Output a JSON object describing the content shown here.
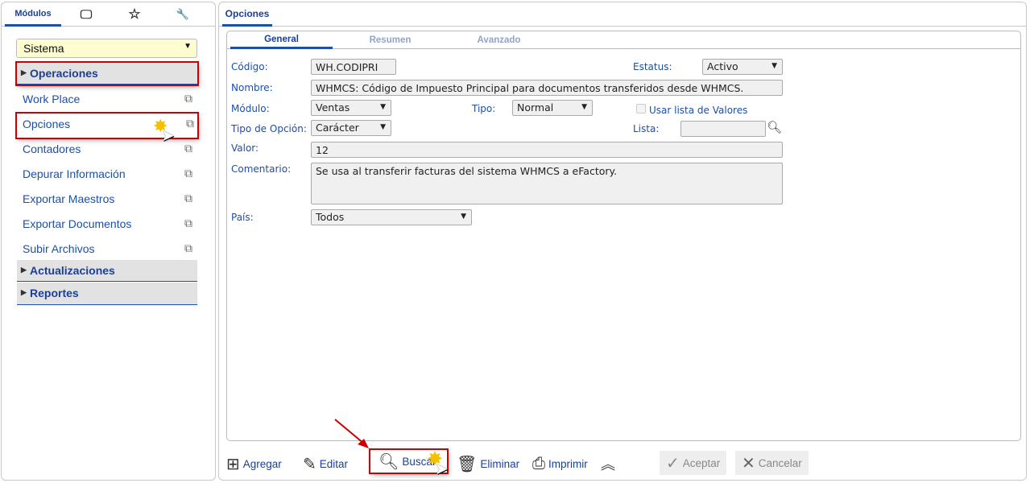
{
  "sidebar": {
    "tabs": [
      {
        "label": "Módulos"
      },
      {
        "icon": "monitor-icon"
      },
      {
        "icon": "star-icon"
      },
      {
        "icon": "tool-icon"
      }
    ],
    "module_select": "Sistema",
    "sections": [
      {
        "label": "Operaciones"
      },
      {
        "label": "Actualizaciones"
      },
      {
        "label": "Reportes"
      }
    ],
    "items": [
      {
        "label": "Work Place"
      },
      {
        "label": "Opciones"
      },
      {
        "label": "Contadores"
      },
      {
        "label": "Depurar Información"
      },
      {
        "label": "Exportar Maestros"
      },
      {
        "label": "Exportar Documentos"
      },
      {
        "label": "Subir Archivos"
      }
    ]
  },
  "main": {
    "tab": "Opciones",
    "subtabs": [
      "General",
      "Resumen",
      "Avanzado"
    ],
    "form": {
      "codigo_label": "Código:",
      "codigo": "WH.CODIPRI",
      "estatus_label": "Estatus:",
      "estatus": "Activo",
      "nombre_label": "Nombre:",
      "nombre": "WHMCS: Código de Impuesto Principal para documentos transferidos desde WHMCS.",
      "modulo_label": "Módulo:",
      "modulo": "Ventas",
      "tipo_label": "Tipo:",
      "tipo": "Normal",
      "usar_lista_label": "Usar lista de Valores",
      "tipo_opcion_label": "Tipo de Opción:",
      "tipo_opcion": "Carácter",
      "lista_label": "Lista:",
      "lista": "",
      "valor_label": "Valor:",
      "valor": "12",
      "comentario_label": "Comentario:",
      "comentario": "Se usa al transferir facturas del sistema WHMCS a eFactory.",
      "pais_label": "País:",
      "pais": "Todos"
    },
    "toolbar": {
      "agregar": "Agregar",
      "editar": "Editar",
      "buscar": "Buscar",
      "eliminar": "Eliminar",
      "imprimir": "Imprimir",
      "aceptar": "Aceptar",
      "cancelar": "Cancelar"
    }
  }
}
